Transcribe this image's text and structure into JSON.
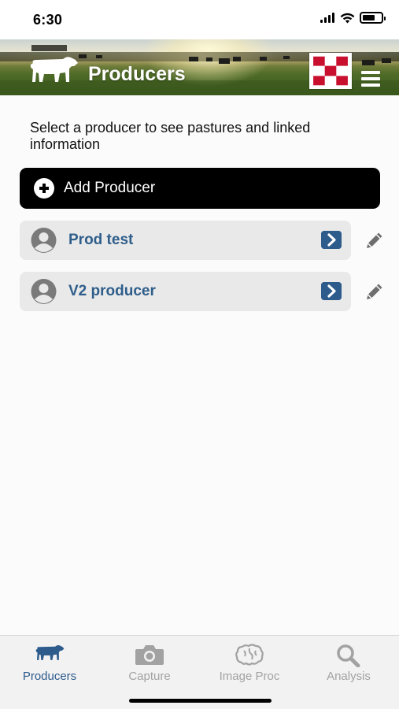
{
  "status_bar": {
    "time": "6:30",
    "icons": [
      "cellular-signal-icon",
      "wifi-icon",
      "battery-icon"
    ]
  },
  "header": {
    "title": "Producers",
    "logo_icon": "cow-icon",
    "brand_logo": "checkerboard-logo",
    "menu_icon": "hamburger-menu-icon",
    "colors": {
      "brand_red": "#c8102e",
      "title": "#ffffff"
    }
  },
  "main": {
    "instruction": "Select a producer to see pastures and linked information",
    "add_button": {
      "label": "Add Producer",
      "icon": "plus-circle-icon"
    },
    "producers": [
      {
        "name": "Prod test",
        "avatar_icon": "user-icon",
        "open_icon": "chevron-right-icon",
        "edit_icon": "pencil-icon"
      },
      {
        "name": "V2 producer",
        "avatar_icon": "user-icon",
        "open_icon": "chevron-right-icon",
        "edit_icon": "pencil-icon"
      }
    ]
  },
  "tab_bar": {
    "tabs": [
      {
        "label": "Producers",
        "icon": "cow-icon",
        "active": true
      },
      {
        "label": "Capture",
        "icon": "camera-icon",
        "active": false
      },
      {
        "label": "Image Proc",
        "icon": "brain-icon",
        "active": false
      },
      {
        "label": "Analysis",
        "icon": "magnifier-icon",
        "active": false
      }
    ],
    "colors": {
      "active": "#2d5b8c",
      "inactive": "#a2a2a2"
    }
  }
}
